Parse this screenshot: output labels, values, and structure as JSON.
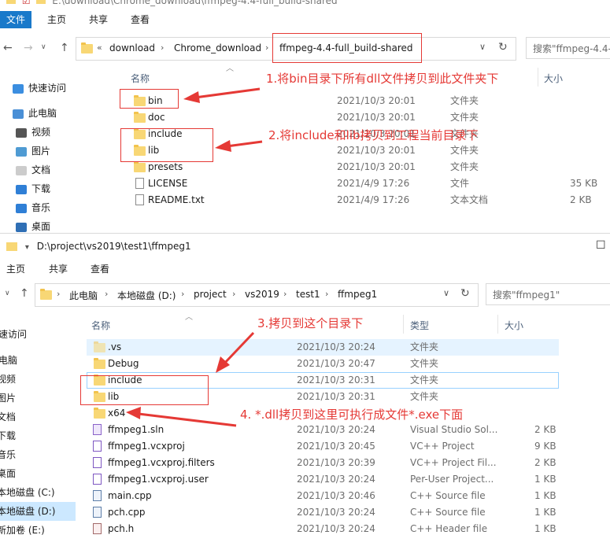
{
  "win1": {
    "titlebar": "E:\\download\\Chrome_download\\ffmpeg-4.4-full_build-shared",
    "tabs": {
      "file": "文件",
      "home": "主页",
      "share": "共享",
      "view": "查看"
    },
    "crumbs": {
      "lead": "«",
      "a": "download",
      "b": "Chrome_download",
      "c": "ffmpeg-4.4-full_build-shared"
    },
    "search_placeholder": "搜索\"ffmpeg-4.4-",
    "headers": {
      "name": "名称",
      "size": "大小"
    },
    "nav": {
      "quick": "快速访问",
      "pc": "此电脑",
      "video": "视频",
      "pictures": "图片",
      "docs": "文档",
      "downloads": "下载",
      "music": "音乐",
      "desktop": "桌面"
    },
    "files": [
      {
        "name": "bin",
        "date": "2021/10/3 20:01",
        "type": "文件夹",
        "size": ""
      },
      {
        "name": "doc",
        "date": "2021/10/3 20:01",
        "type": "文件夹",
        "size": ""
      },
      {
        "name": "include",
        "date": "2021/10/3 20:01",
        "type": "文件夹",
        "size": ""
      },
      {
        "name": "lib",
        "date": "2021/10/3 20:01",
        "type": "文件夹",
        "size": ""
      },
      {
        "name": "presets",
        "date": "2021/10/3 20:01",
        "type": "文件夹",
        "size": ""
      },
      {
        "name": "LICENSE",
        "date": "2021/4/9 17:26",
        "type": "文件",
        "size": "35 KB"
      },
      {
        "name": "README.txt",
        "date": "2021/4/9 17:26",
        "type": "文本文档",
        "size": "2 KB"
      }
    ],
    "annotations": {
      "a1": "1.将bin目录下所有dll文件拷贝到此文件夹下",
      "a2": "2.将include和lib拷贝到工程当前目录下"
    }
  },
  "win2": {
    "titlebar": "D:\\project\\vs2019\\test1\\ffmpeg1",
    "tabs": {
      "home": "主页",
      "share": "共享",
      "view": "查看"
    },
    "crumbs": {
      "a": "此电脑",
      "b": "本地磁盘 (D:)",
      "c": "project",
      "d": "vs2019",
      "e": "test1",
      "f": "ffmpeg1"
    },
    "search_placeholder": "搜索\"ffmpeg1\"",
    "headers": {
      "name": "名称",
      "type": "类型",
      "size": "大小"
    },
    "nav": {
      "quick": "速访问",
      "pc": "电脑",
      "video": "视频",
      "pictures": "图片",
      "docs": "文档",
      "downloads": "下载",
      "music": "音乐",
      "desktop": "桌面",
      "c_drive": "本地磁盘 (C:)",
      "d_drive": "本地磁盘 (D:)",
      "e_drive": "新加卷 (E:)"
    },
    "files": [
      {
        "name": ".vs",
        "date": "2021/10/3 20:24",
        "type": "文件夹",
        "size": ""
      },
      {
        "name": "Debug",
        "date": "2021/10/3 20:47",
        "type": "文件夹",
        "size": ""
      },
      {
        "name": "include",
        "date": "2021/10/3 20:31",
        "type": "文件夹",
        "size": ""
      },
      {
        "name": "lib",
        "date": "2021/10/3 20:31",
        "type": "文件夹",
        "size": ""
      },
      {
        "name": "x64",
        "date": "",
        "type": "",
        "size": ""
      },
      {
        "name": "ffmpeg1.sln",
        "date": "2021/10/3 20:24",
        "type": "Visual Studio Sol...",
        "size": "2 KB"
      },
      {
        "name": "ffmpeg1.vcxproj",
        "date": "2021/10/3 20:45",
        "type": "VC++ Project",
        "size": "9 KB"
      },
      {
        "name": "ffmpeg1.vcxproj.filters",
        "date": "2021/10/3 20:39",
        "type": "VC++ Project Fil...",
        "size": "2 KB"
      },
      {
        "name": "ffmpeg1.vcxproj.user",
        "date": "2021/10/3 20:24",
        "type": "Per-User Project...",
        "size": "1 KB"
      },
      {
        "name": "main.cpp",
        "date": "2021/10/3 20:46",
        "type": "C++ Source file",
        "size": "1 KB"
      },
      {
        "name": "pch.cpp",
        "date": "2021/10/3 20:24",
        "type": "C++ Source file",
        "size": "1 KB"
      },
      {
        "name": "pch.h",
        "date": "2021/10/3 20:24",
        "type": "C++ Header file",
        "size": "1 KB"
      }
    ],
    "annotations": {
      "a3": "3.拷贝到这个目录下",
      "a4": "4. *.dll拷贝到这里可执行成文件*.exe下面"
    }
  },
  "colors": {
    "accent": "#1979ca",
    "annotation": "#e53935",
    "folder": "#f8d775"
  }
}
